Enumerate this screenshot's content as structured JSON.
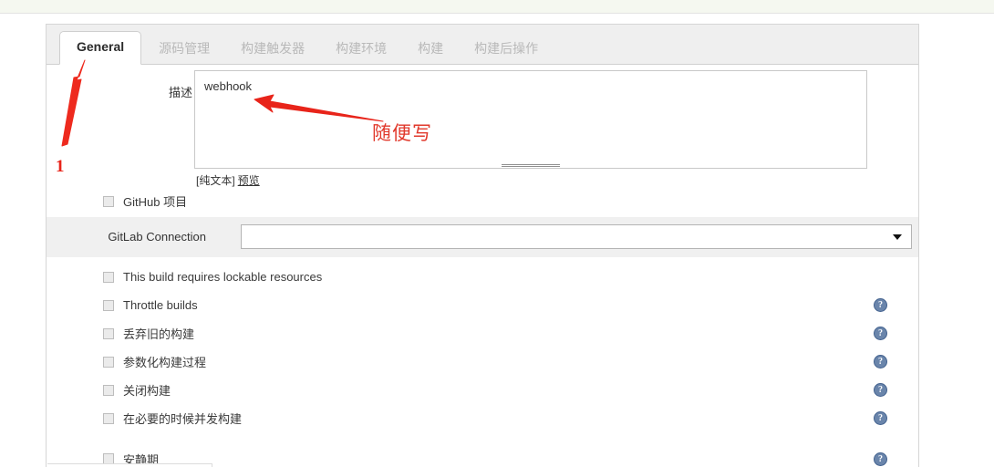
{
  "tabs": [
    {
      "label": "General",
      "active": true
    },
    {
      "label": "源码管理",
      "active": false
    },
    {
      "label": "构建触发器",
      "active": false
    },
    {
      "label": "构建环境",
      "active": false
    },
    {
      "label": "构建",
      "active": false
    },
    {
      "label": "构建后操作",
      "active": false
    }
  ],
  "description": {
    "label": "描述",
    "value": "webhook",
    "placeholder": "",
    "plain_text_label": "[纯文本]",
    "preview_label": "预览"
  },
  "github_project": {
    "label": "GitHub 项目",
    "checked": false
  },
  "gitlab_connection": {
    "label": "GitLab Connection",
    "value": "",
    "arrow_icon": "chevron-down-icon"
  },
  "options": [
    {
      "label": "This build requires lockable resources",
      "checked": false,
      "help": false
    },
    {
      "label": "Throttle builds",
      "checked": false,
      "help": true
    },
    {
      "label": "丢弃旧的构建",
      "checked": false,
      "help": true
    },
    {
      "label": "参数化构建过程",
      "checked": false,
      "help": true
    },
    {
      "label": "关闭构建",
      "checked": false,
      "help": true
    },
    {
      "label": "在必要的时候并发构建",
      "checked": false,
      "help": true
    }
  ],
  "bottom_partial_option": {
    "label": "安静期",
    "checked": false
  },
  "annotations": {
    "step_number": "1",
    "note_text": "随便写",
    "arrow_to_tab": "red-arrow-up",
    "arrow_to_description": "red-arrow-left"
  },
  "colors": {
    "annotation_red": "#e1392c",
    "tab_bar_bg": "#efefef",
    "help_icon_blue": "#6a85ab",
    "row_highlight": "#f0f0f0"
  },
  "help_icon_glyph": "?"
}
